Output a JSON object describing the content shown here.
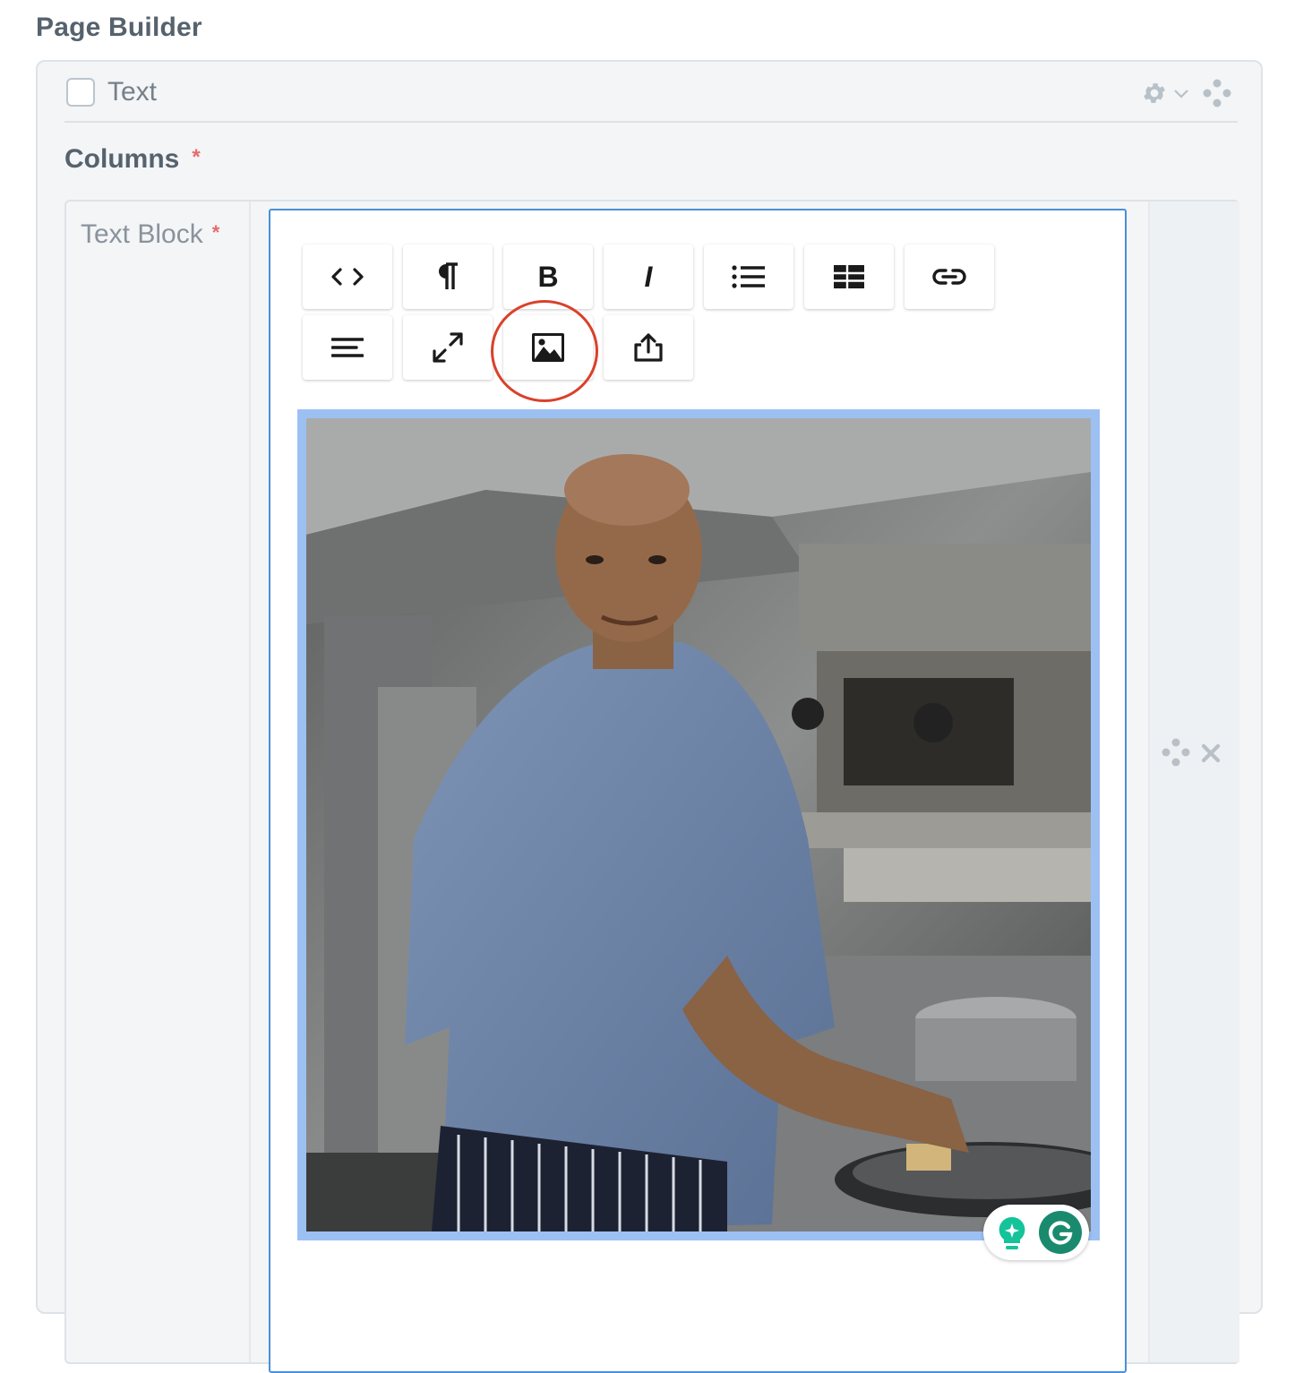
{
  "page": {
    "title": "Page Builder"
  },
  "block": {
    "type_label": "Text",
    "columns_label": "Columns",
    "required_marker": "*",
    "column": {
      "label": "Text Block"
    }
  },
  "toolbar": {
    "buttons": [
      {
        "name": "html-source",
        "icon": "code-icon"
      },
      {
        "name": "paragraph",
        "icon": "pilcrow-icon"
      },
      {
        "name": "bold",
        "icon": "bold-icon",
        "glyph": "B"
      },
      {
        "name": "italic",
        "icon": "italic-icon",
        "glyph": "I"
      },
      {
        "name": "unordered-list",
        "icon": "list-icon"
      },
      {
        "name": "table",
        "icon": "table-icon"
      },
      {
        "name": "link",
        "icon": "link-icon"
      },
      {
        "name": "align",
        "icon": "align-icon"
      },
      {
        "name": "fullscreen",
        "icon": "expand-icon"
      },
      {
        "name": "image",
        "icon": "image-icon",
        "highlighted": true
      },
      {
        "name": "upload",
        "icon": "upload-icon"
      }
    ]
  },
  "editor": {
    "image": {
      "subject": "chef-in-kitchen-photo"
    }
  },
  "colors": {
    "editor_border": "#4a90d9",
    "image_selection": "#9dc0f2",
    "highlight_circle": "#d9412b",
    "required": "#e56b6b",
    "grammarly": "#15c39a"
  }
}
